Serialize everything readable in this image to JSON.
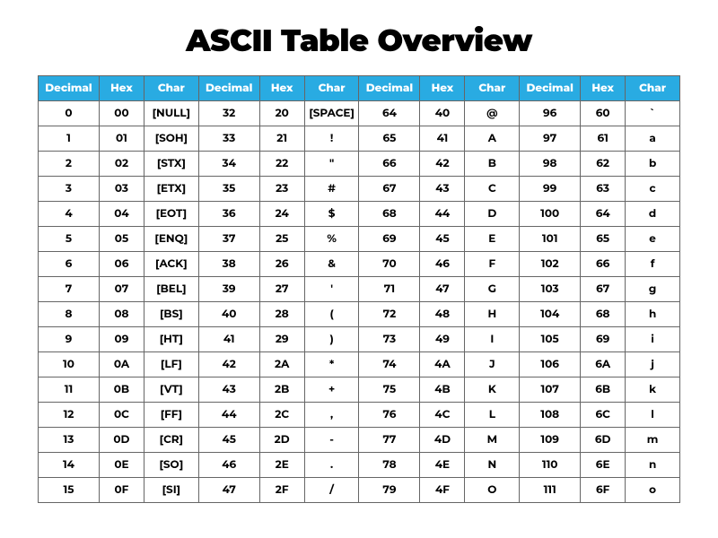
{
  "title": "ASCII Table Overview",
  "chart_data": {
    "type": "table",
    "title": "ASCII Table Overview",
    "header_accent": "#29abe2",
    "column_groups": 4,
    "columns": [
      "Decimal",
      "Hex",
      "Char"
    ],
    "rows": [
      [
        {
          "dec": "0",
          "hex": "00",
          "char": "[NULL]"
        },
        {
          "dec": "32",
          "hex": "20",
          "char": "[SPACE]"
        },
        {
          "dec": "64",
          "hex": "40",
          "char": "@"
        },
        {
          "dec": "96",
          "hex": "60",
          "char": "`"
        }
      ],
      [
        {
          "dec": "1",
          "hex": "01",
          "char": "[SOH]"
        },
        {
          "dec": "33",
          "hex": "21",
          "char": "!"
        },
        {
          "dec": "65",
          "hex": "41",
          "char": "A"
        },
        {
          "dec": "97",
          "hex": "61",
          "char": "a"
        }
      ],
      [
        {
          "dec": "2",
          "hex": "02",
          "char": "[STX]"
        },
        {
          "dec": "34",
          "hex": "22",
          "char": "\""
        },
        {
          "dec": "66",
          "hex": "42",
          "char": "B"
        },
        {
          "dec": "98",
          "hex": "62",
          "char": "b"
        }
      ],
      [
        {
          "dec": "3",
          "hex": "03",
          "char": "[ETX]"
        },
        {
          "dec": "35",
          "hex": "23",
          "char": "#"
        },
        {
          "dec": "67",
          "hex": "43",
          "char": "C"
        },
        {
          "dec": "99",
          "hex": "63",
          "char": "c"
        }
      ],
      [
        {
          "dec": "4",
          "hex": "04",
          "char": "[EOT]"
        },
        {
          "dec": "36",
          "hex": "24",
          "char": "$"
        },
        {
          "dec": "68",
          "hex": "44",
          "char": "D"
        },
        {
          "dec": "100",
          "hex": "64",
          "char": "d"
        }
      ],
      [
        {
          "dec": "5",
          "hex": "05",
          "char": "[ENQ]"
        },
        {
          "dec": "37",
          "hex": "25",
          "char": "%"
        },
        {
          "dec": "69",
          "hex": "45",
          "char": "E"
        },
        {
          "dec": "101",
          "hex": "65",
          "char": "e"
        }
      ],
      [
        {
          "dec": "6",
          "hex": "06",
          "char": "[ACK]"
        },
        {
          "dec": "38",
          "hex": "26",
          "char": "&"
        },
        {
          "dec": "70",
          "hex": "46",
          "char": "F"
        },
        {
          "dec": "102",
          "hex": "66",
          "char": "f"
        }
      ],
      [
        {
          "dec": "7",
          "hex": "07",
          "char": "[BEL]"
        },
        {
          "dec": "39",
          "hex": "27",
          "char": "'"
        },
        {
          "dec": "71",
          "hex": "47",
          "char": "G"
        },
        {
          "dec": "103",
          "hex": "67",
          "char": "g"
        }
      ],
      [
        {
          "dec": "8",
          "hex": "08",
          "char": "[BS]"
        },
        {
          "dec": "40",
          "hex": "28",
          "char": "("
        },
        {
          "dec": "72",
          "hex": "48",
          "char": "H"
        },
        {
          "dec": "104",
          "hex": "68",
          "char": "h"
        }
      ],
      [
        {
          "dec": "9",
          "hex": "09",
          "char": "[HT]"
        },
        {
          "dec": "41",
          "hex": "29",
          "char": ")"
        },
        {
          "dec": "73",
          "hex": "49",
          "char": "I"
        },
        {
          "dec": "105",
          "hex": "69",
          "char": "i"
        }
      ],
      [
        {
          "dec": "10",
          "hex": "0A",
          "char": "[LF]"
        },
        {
          "dec": "42",
          "hex": "2A",
          "char": "*"
        },
        {
          "dec": "74",
          "hex": "4A",
          "char": "J"
        },
        {
          "dec": "106",
          "hex": "6A",
          "char": "j"
        }
      ],
      [
        {
          "dec": "11",
          "hex": "0B",
          "char": "[VT]"
        },
        {
          "dec": "43",
          "hex": "2B",
          "char": "+"
        },
        {
          "dec": "75",
          "hex": "4B",
          "char": "K"
        },
        {
          "dec": "107",
          "hex": "6B",
          "char": "k"
        }
      ],
      [
        {
          "dec": "12",
          "hex": "0C",
          "char": "[FF]"
        },
        {
          "dec": "44",
          "hex": "2C",
          "char": ","
        },
        {
          "dec": "76",
          "hex": "4C",
          "char": "L"
        },
        {
          "dec": "108",
          "hex": "6C",
          "char": "l"
        }
      ],
      [
        {
          "dec": "13",
          "hex": "0D",
          "char": "[CR]"
        },
        {
          "dec": "45",
          "hex": "2D",
          "char": "-"
        },
        {
          "dec": "77",
          "hex": "4D",
          "char": "M"
        },
        {
          "dec": "109",
          "hex": "6D",
          "char": "m"
        }
      ],
      [
        {
          "dec": "14",
          "hex": "0E",
          "char": "[SO]"
        },
        {
          "dec": "46",
          "hex": "2E",
          "char": "."
        },
        {
          "dec": "78",
          "hex": "4E",
          "char": "N"
        },
        {
          "dec": "110",
          "hex": "6E",
          "char": "n"
        }
      ],
      [
        {
          "dec": "15",
          "hex": "0F",
          "char": "[SI]"
        },
        {
          "dec": "47",
          "hex": "2F",
          "char": "/"
        },
        {
          "dec": "79",
          "hex": "4F",
          "char": "O"
        },
        {
          "dec": "111",
          "hex": "6F",
          "char": "o"
        }
      ]
    ]
  }
}
